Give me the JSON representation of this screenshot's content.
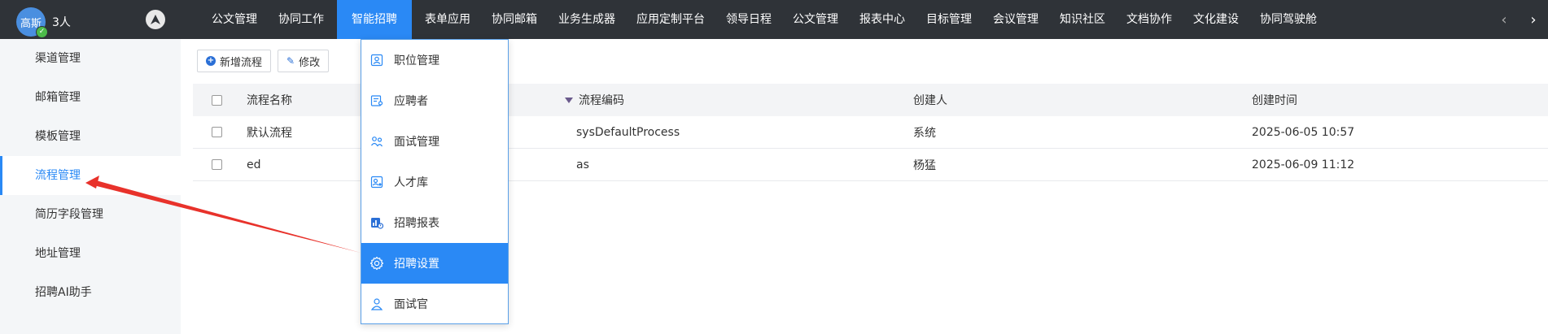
{
  "header": {
    "user": {
      "avatar_text": "高斯",
      "member_count": "3人"
    },
    "nav": [
      {
        "label": "公文管理"
      },
      {
        "label": "协同工作"
      },
      {
        "label": "智能招聘",
        "active": true
      },
      {
        "label": "表单应用"
      },
      {
        "label": "协同邮箱"
      },
      {
        "label": "业务生成器"
      },
      {
        "label": "应用定制平台"
      },
      {
        "label": "领导日程"
      },
      {
        "label": "公文管理"
      },
      {
        "label": "报表中心"
      },
      {
        "label": "目标管理"
      },
      {
        "label": "会议管理"
      },
      {
        "label": "知识社区"
      },
      {
        "label": "文档协作"
      },
      {
        "label": "文化建设"
      },
      {
        "label": "协同驾驶舱"
      }
    ],
    "prev_arrow": "‹",
    "next_arrow": "›"
  },
  "sidebar": {
    "items": [
      {
        "label": "渠道管理"
      },
      {
        "label": "邮箱管理"
      },
      {
        "label": "模板管理"
      },
      {
        "label": "流程管理",
        "active": true
      },
      {
        "label": "简历字段管理"
      },
      {
        "label": "地址管理"
      },
      {
        "label": "招聘AI助手"
      }
    ]
  },
  "toolbar": {
    "add_label": "新增流程",
    "edit_label": "修改"
  },
  "table": {
    "columns": [
      "流程名称",
      "流程编码",
      "创建人",
      "创建时间"
    ],
    "rows": [
      {
        "name": "默认流程",
        "code": "sysDefaultProcess",
        "creator": "系统",
        "time": "2025-06-05 10:57"
      },
      {
        "name": "ed",
        "code": "as",
        "creator": "杨猛",
        "time": "2025-06-09 11:12"
      }
    ]
  },
  "dropdown": {
    "items": [
      {
        "label": "职位管理",
        "icon": "position-icon"
      },
      {
        "label": "应聘者",
        "icon": "applicant-icon"
      },
      {
        "label": "面试管理",
        "icon": "interview-icon"
      },
      {
        "label": "人才库",
        "icon": "talent-pool-icon"
      },
      {
        "label": "招聘报表",
        "icon": "report-icon"
      },
      {
        "label": "招聘设置",
        "icon": "gear-icon",
        "active": true
      },
      {
        "label": "面试官",
        "icon": "interviewer-icon"
      }
    ]
  },
  "colors": {
    "topbar": "#2f3338",
    "accent": "#2a89f5",
    "annotation_arrow": "#e8322b"
  }
}
